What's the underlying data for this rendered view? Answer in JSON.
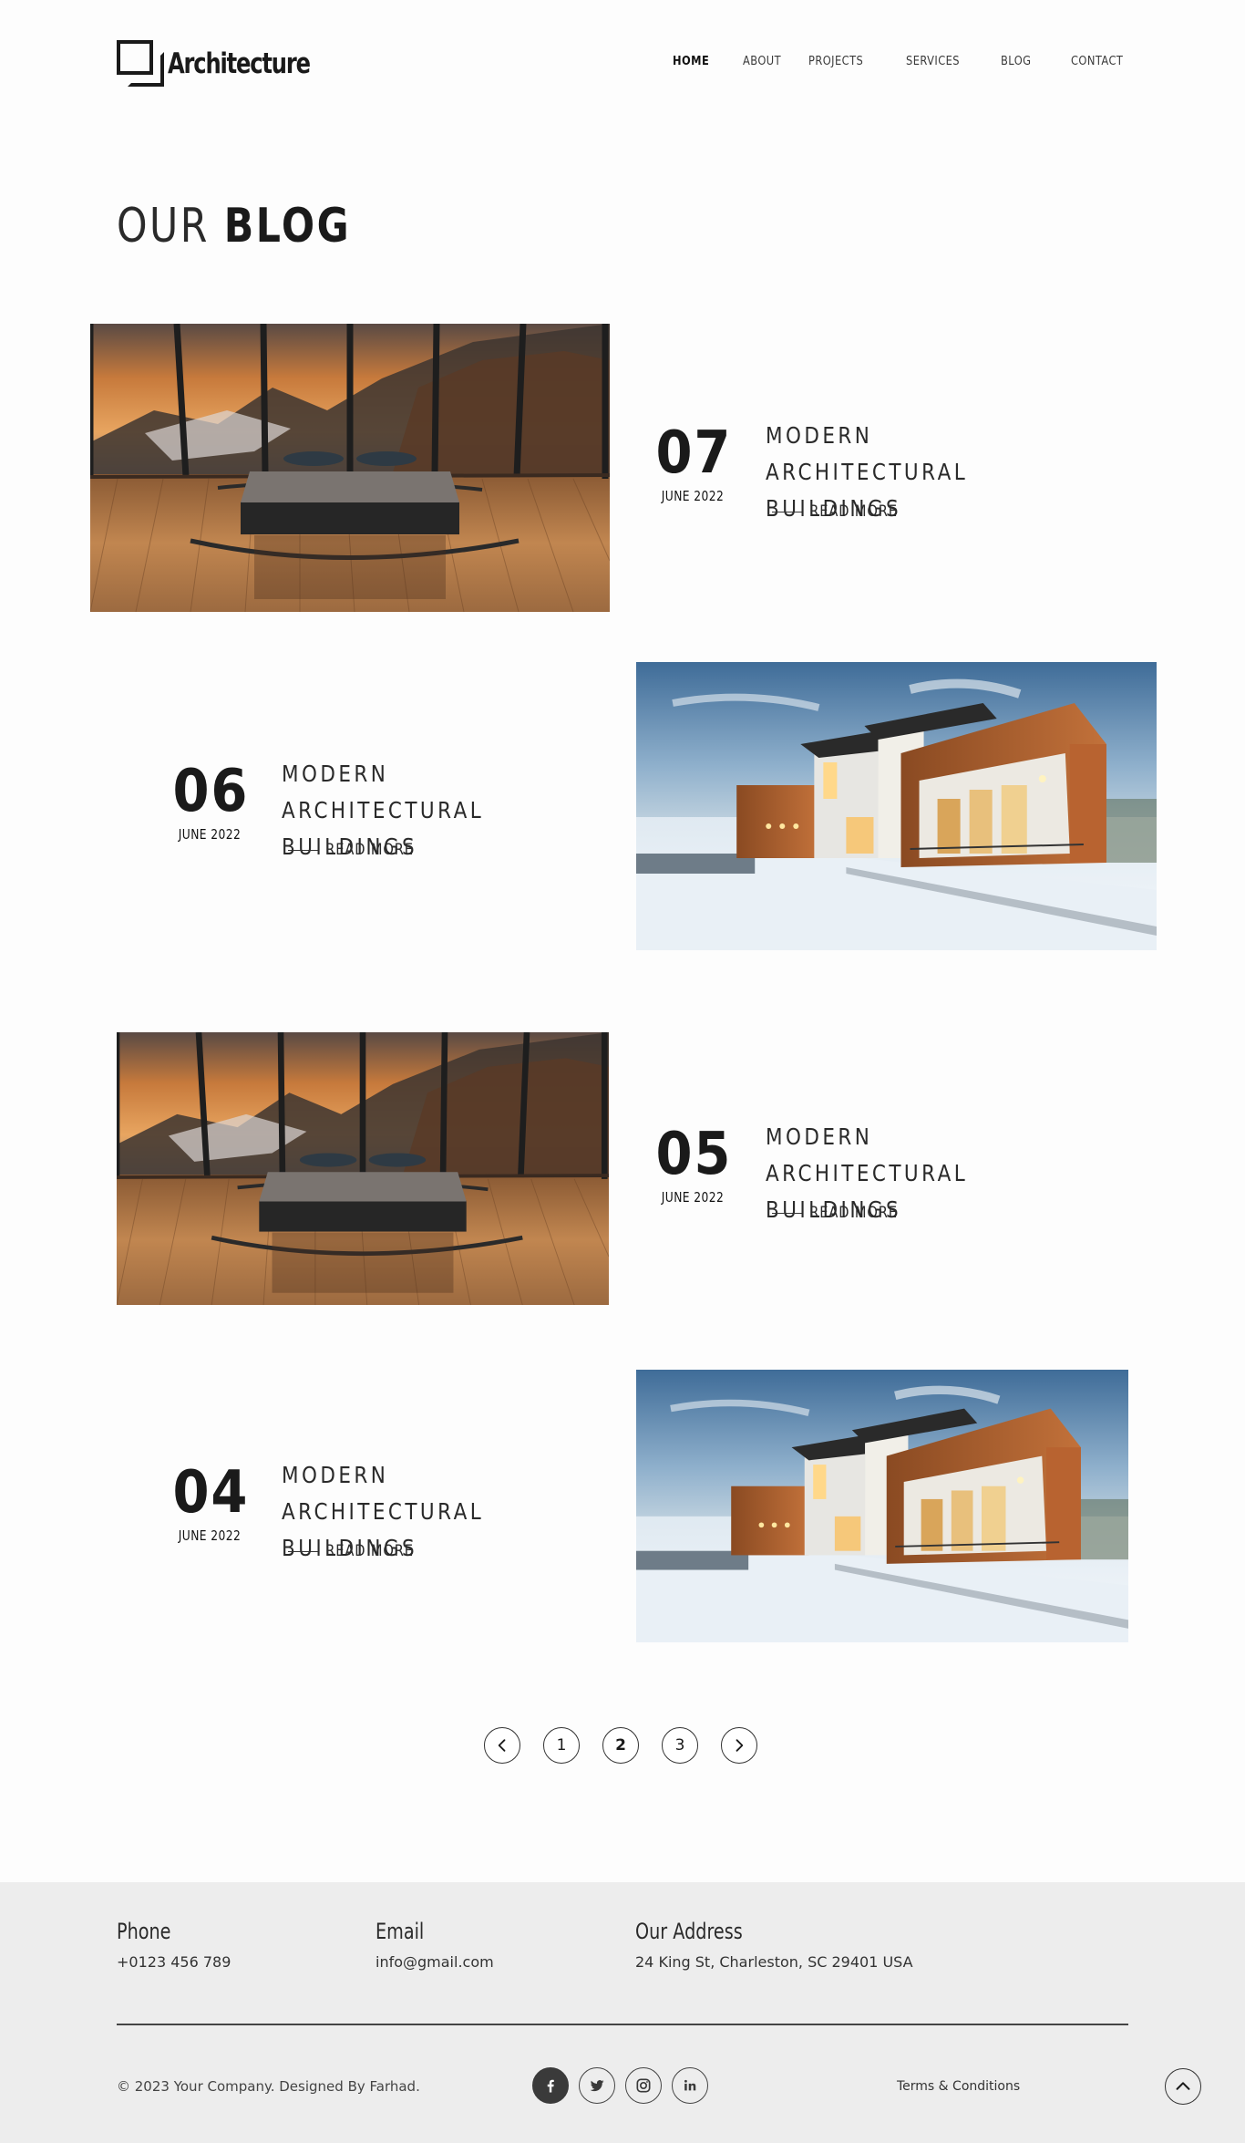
{
  "header": {
    "logo_text": "Architecture",
    "nav": [
      {
        "label": "HOME",
        "active": true
      },
      {
        "label": "ABOUT",
        "active": false
      },
      {
        "label": "PROJECTS",
        "active": false
      },
      {
        "label": "SERVICES",
        "active": false
      },
      {
        "label": "BLOG",
        "active": false
      },
      {
        "label": "CONTACT",
        "active": false
      }
    ]
  },
  "page_title": {
    "light": "OUR",
    "bold": "BLOG"
  },
  "posts": [
    {
      "day": "07",
      "month": "JUNE 2022",
      "title": "MODERN ARCHITECTURAL BUILDINGS",
      "read_more": "READ MORE",
      "image": "bedroom-mountain-view-photo"
    },
    {
      "day": "06",
      "month": "JUNE 2022",
      "title": "MODERN ARCHITECTURAL BUILDINGS",
      "read_more": "READ MORE",
      "image": "modern-house-snow-photo"
    },
    {
      "day": "05",
      "month": "JUNE 2022",
      "title": "MODERN ARCHITECTURAL BUILDINGS",
      "read_more": "READ MORE",
      "image": "bedroom-mountain-view-photo"
    },
    {
      "day": "04",
      "month": "JUNE 2022",
      "title": "MODERN ARCHITECTURAL BUILDINGS",
      "read_more": "READ MORE",
      "image": "modern-house-snow-photo"
    }
  ],
  "pagination": {
    "prev_icon": "chevron-left-icon",
    "pages": [
      "1",
      "2",
      "3"
    ],
    "current": "2",
    "next_icon": "chevron-right-icon"
  },
  "footer": {
    "phone_label": "Phone",
    "phone": "+0123 456 789",
    "email_label": "Email",
    "email": "info@gmail.com",
    "address_label": "Our Address",
    "address": "24  King St, Charleston, SC 29401 USA",
    "copyright": "© 2023 Your Company. Designed By Farhad.",
    "socials": [
      "facebook-icon",
      "twitter-icon",
      "instagram-icon",
      "linkedin-icon"
    ],
    "terms": "Terms & Conditions",
    "to_top_icon": "chevron-up-icon"
  },
  "colors": {
    "text": "#1a1a1a",
    "footer_bg": "#ededed",
    "page_bg": "#fdfdfd"
  }
}
